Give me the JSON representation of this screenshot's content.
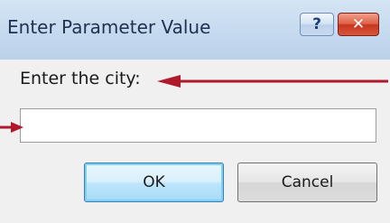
{
  "window": {
    "title": "Enter Parameter Value",
    "help_label": "?",
    "close_label": "✕"
  },
  "prompt": {
    "label": "Enter the city:"
  },
  "input": {
    "value": "",
    "placeholder": ""
  },
  "buttons": {
    "ok_label": "OK",
    "cancel_label": "Cancel"
  },
  "icons": {
    "help": "help-icon",
    "close": "close-icon",
    "annotation_arrow": "arrow-icon"
  },
  "colors": {
    "title_bar": "#c4d8ee",
    "close_button": "#d6573b",
    "annotation_arrow": "#b0182c",
    "ok_focus": "#3c7fb1"
  }
}
